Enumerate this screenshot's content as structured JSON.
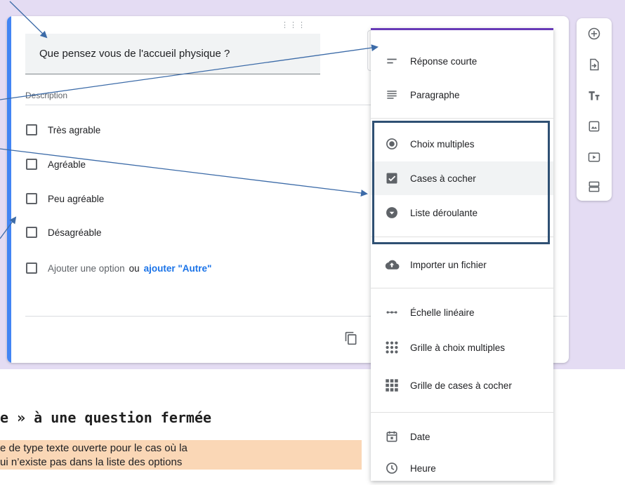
{
  "question": {
    "title": "Que pensez vous de l'accueil physique ?",
    "description_placeholder": "Description",
    "options": [
      "Très agrable",
      "Agréable",
      "Peu agréable",
      "Désagréable"
    ],
    "add_option": "Ajouter une option",
    "add_or": "ou",
    "add_other": "ajouter \"Autre\""
  },
  "toolbar": {
    "items": [
      "add-question-icon",
      "import-questions-icon",
      "add-title-icon",
      "add-image-icon",
      "add-video-icon",
      "add-section-icon"
    ]
  },
  "menu": {
    "items": [
      {
        "label": "Réponse courte",
        "icon": "short-answer-icon"
      },
      {
        "label": "Paragraphe",
        "icon": "paragraph-icon"
      },
      {
        "label": "Choix multiples",
        "icon": "radio-icon"
      },
      {
        "label": "Cases à cocher",
        "icon": "checkbox-icon"
      },
      {
        "label": "Liste déroulante",
        "icon": "dropdown-icon"
      },
      {
        "label": "Importer un fichier",
        "icon": "cloud-upload-icon"
      },
      {
        "label": "Échelle linéaire",
        "icon": "linear-scale-icon"
      },
      {
        "label": "Grille à choix multiples",
        "icon": "radio-grid-icon"
      },
      {
        "label": "Grille de cases à cocher",
        "icon": "checkbox-grid-icon"
      },
      {
        "label": "Date",
        "icon": "calendar-icon"
      },
      {
        "label": "Heure",
        "icon": "clock-icon"
      }
    ]
  },
  "document": {
    "heading": "e » à une question fermée",
    "note_lines": [
      "e de type texte ouverte pour le cas où la",
      "ui n’existe pas dans la liste des options"
    ]
  },
  "colors": {
    "accent": "#4285f4",
    "link": "#1a73e8",
    "menu_top": "#673ab7",
    "group_border": "#2f5073",
    "band": "#e4dcf3",
    "note_bg": "#fad7b6",
    "arrow": "#3c6ba8"
  }
}
